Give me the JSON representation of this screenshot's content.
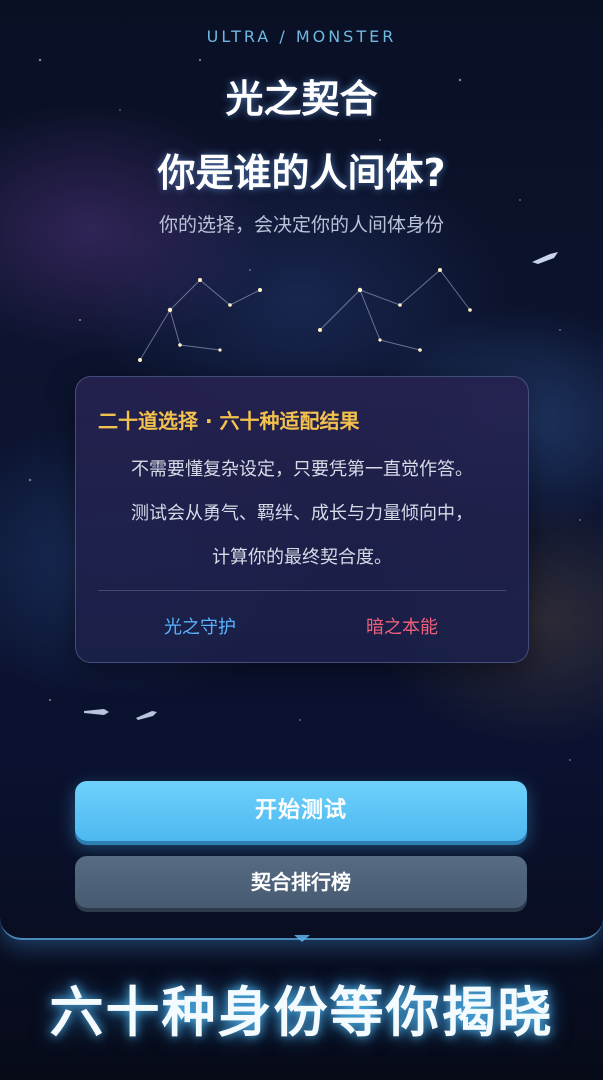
{
  "header": {
    "eyebrow": "ULTRA / MONSTER",
    "title": "光之契合",
    "subtitle": "你是谁的人间体?",
    "tagline": "你的选择，会决定你的人间体身份"
  },
  "card": {
    "heading": "二十道选择 · 六十种适配结果",
    "lines": [
      "不需要懂复杂设定，只要凭第一直觉作答。",
      "测试会从勇气、羁绊、成长与力量倾向中，",
      "计算你的最终契合度。"
    ],
    "tag_light": "光之守护",
    "tag_dark": "暗之本能"
  },
  "buttons": {
    "start": "开始测试",
    "ranking": "契合排行榜"
  },
  "footer": {
    "slogan": "六十种身份等你揭晓"
  },
  "colors": {
    "accent_blue": "#4db8f0",
    "heading_gold": "#f2c14e",
    "light_tag": "#5ab2ff",
    "dark_tag": "#f0607a",
    "secondary_button": "#576b83"
  }
}
